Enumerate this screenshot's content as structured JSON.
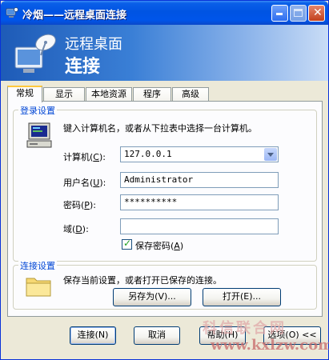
{
  "window": {
    "title": "冷烟——远程桌面连接"
  },
  "banner": {
    "line1": "远程桌面",
    "line2": "连接"
  },
  "tabs": [
    {
      "label": "常规",
      "active": true
    },
    {
      "label": "显示",
      "active": false
    },
    {
      "label": "本地资源",
      "active": false
    },
    {
      "label": "程序",
      "active": false
    },
    {
      "label": "高级",
      "active": false
    }
  ],
  "login": {
    "group_label": "登录设置",
    "instruction": "键入计算机名，或者从下拉表中选择一台计算机。",
    "computer_label": "计算机",
    "computer_key": "C",
    "computer_value": "127.0.0.1",
    "username_label": "用户名",
    "username_key": "U",
    "username_value": "Administrator",
    "password_label": "密码",
    "password_key": "P",
    "password_value": "**********",
    "domain_label": "域",
    "domain_key": "D",
    "domain_value": "",
    "save_password_label": "保存密码",
    "save_password_key": "A",
    "save_password_checked": true
  },
  "connection": {
    "group_label": "连接设置",
    "description": "保存当前设置，或者打开已保存的连接。",
    "save_as_label": "另存为(V)...",
    "open_label": "打开(E)..."
  },
  "footer": {
    "connect_label": "连接(N)",
    "cancel_label": "取消",
    "help_label": "帮助(H)",
    "options_label": "选项(O) <<"
  },
  "watermark": {
    "line1": "科信联合网",
    "line2": "www.kxlzw.com"
  }
}
